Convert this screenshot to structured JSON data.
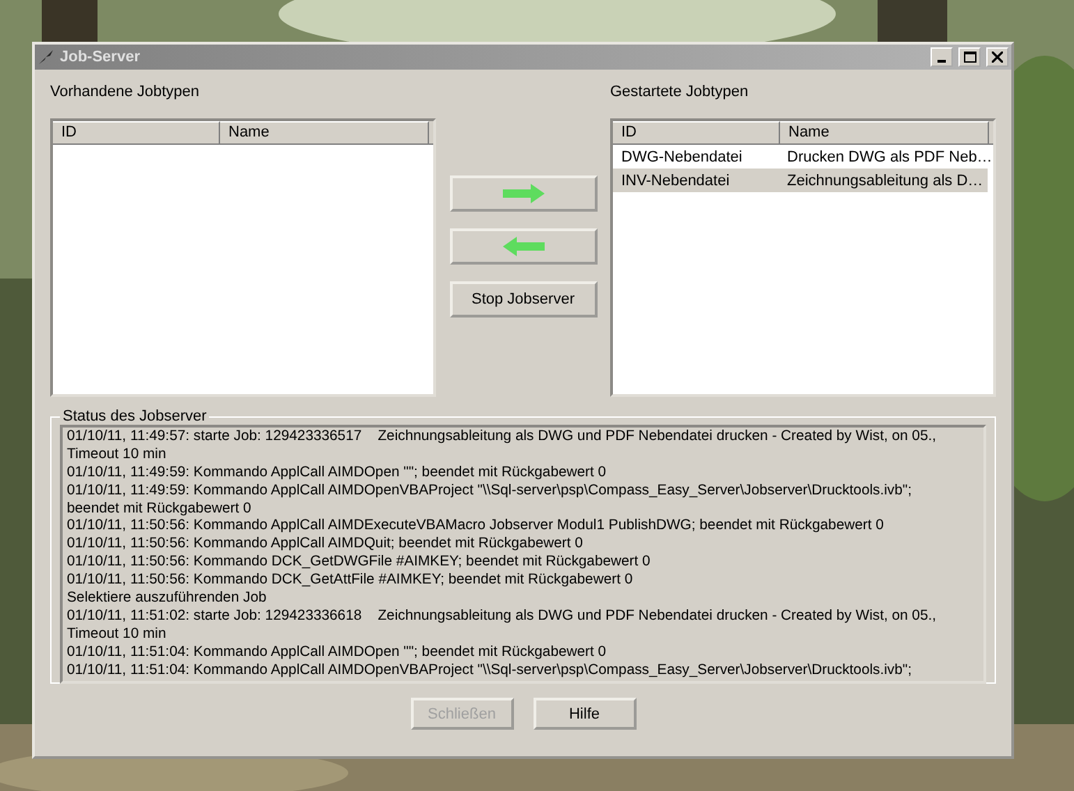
{
  "window": {
    "title": "Job-Server"
  },
  "available": {
    "label": "Vorhandene Jobtypen",
    "columns": [
      "ID",
      "Name"
    ]
  },
  "started": {
    "label": "Gestartete Jobtypen",
    "columns": [
      "ID",
      "Name"
    ],
    "rows": [
      {
        "id": "DWG-Nebendatei",
        "name": "Drucken DWG als PDF Neb…",
        "selected": false
      },
      {
        "id": "INV-Nebendatei",
        "name": "Zeichnungsableitung als D…",
        "selected": true
      }
    ]
  },
  "middle_buttons": [
    {
      "kind": "arrow-right"
    },
    {
      "kind": "arrow-left"
    },
    {
      "kind": "text",
      "label": "Stop Jobserver"
    }
  ],
  "status": {
    "label": "Status des Jobserver",
    "lines": [
      "01/10/11, 11:49:57: starte Job: 129423336517    Zeichnungsableitung als DWG und PDF Nebendatei drucken - Created by Wist, on 05.,",
      "Timeout 10 min",
      "01/10/11, 11:49:59: Kommando ApplCall AIMDOpen \"\"; beendet mit Rückgabewert 0",
      "01/10/11, 11:49:59: Kommando ApplCall AIMDOpenVBAProject \"\\\\Sql-server\\psp\\Compass_Easy_Server\\Jobserver\\Drucktools.ivb\";",
      "beendet mit Rückgabewert 0",
      "01/10/11, 11:50:56: Kommando ApplCall AIMDExecuteVBAMacro Jobserver Modul1 PublishDWG; beendet mit Rückgabewert 0",
      "01/10/11, 11:50:56: Kommando ApplCall AIMDQuit; beendet mit Rückgabewert 0",
      "01/10/11, 11:50:56: Kommando DCK_GetDWGFile #AIMKEY; beendet mit Rückgabewert 0",
      "01/10/11, 11:50:56: Kommando DCK_GetAttFile #AIMKEY; beendet mit Rückgabewert 0",
      "Selektiere auszuführenden Job",
      "01/10/11, 11:51:02: starte Job: 129423336618    Zeichnungsableitung als DWG und PDF Nebendatei drucken - Created by Wist, on 05.,",
      "Timeout 10 min",
      "01/10/11, 11:51:04: Kommando ApplCall AIMDOpen \"\"; beendet mit Rückgabewert 0",
      "01/10/11, 11:51:04: Kommando ApplCall AIMDOpenVBAProject \"\\\\Sql-server\\psp\\Compass_Easy_Server\\Jobserver\\Drucktools.ivb\";"
    ]
  },
  "footer_buttons": [
    {
      "label": "Schließen",
      "disabled": true
    },
    {
      "label": "Hilfe",
      "disabled": false
    }
  ]
}
